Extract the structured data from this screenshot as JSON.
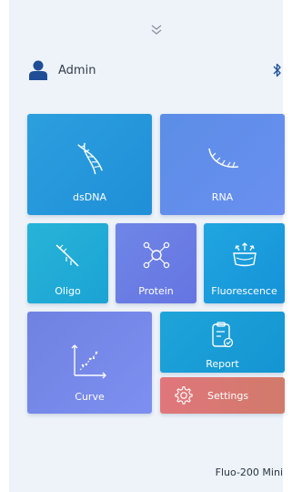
{
  "header": {
    "expand_icon": "chevron-double-down-icon"
  },
  "user": {
    "name": "Admin",
    "icon": "user-icon"
  },
  "status": {
    "bluetooth_icon": "bluetooth-icon"
  },
  "tiles": {
    "dsdna": {
      "label": "dsDNA",
      "icon": "dna-helix-icon"
    },
    "rna": {
      "label": "RNA",
      "icon": "rna-strand-icon"
    },
    "oligo": {
      "label": "Oligo",
      "icon": "oligo-strand-icon"
    },
    "protein": {
      "label": "Protein",
      "icon": "molecule-icon"
    },
    "fluorescence": {
      "label": "Fluorescence",
      "icon": "fluorescence-dish-icon"
    },
    "curve": {
      "label": "Curve",
      "icon": "scatter-curve-icon"
    },
    "report": {
      "label": "Report",
      "icon": "clipboard-report-icon"
    },
    "settings": {
      "label": "Settings",
      "icon": "gear-icon"
    }
  },
  "footer": {
    "model": "Fluo-200 Mini"
  },
  "colors": {
    "background": "#eef3f9",
    "dsdna": "#2399dc",
    "rna": "#6390eb",
    "oligo": "#22acd6",
    "protein": "#6a7de4",
    "fluorescence": "#1b9cdc",
    "curve": "#7688e9",
    "report": "#199dd6",
    "settings": "#d9776f"
  }
}
